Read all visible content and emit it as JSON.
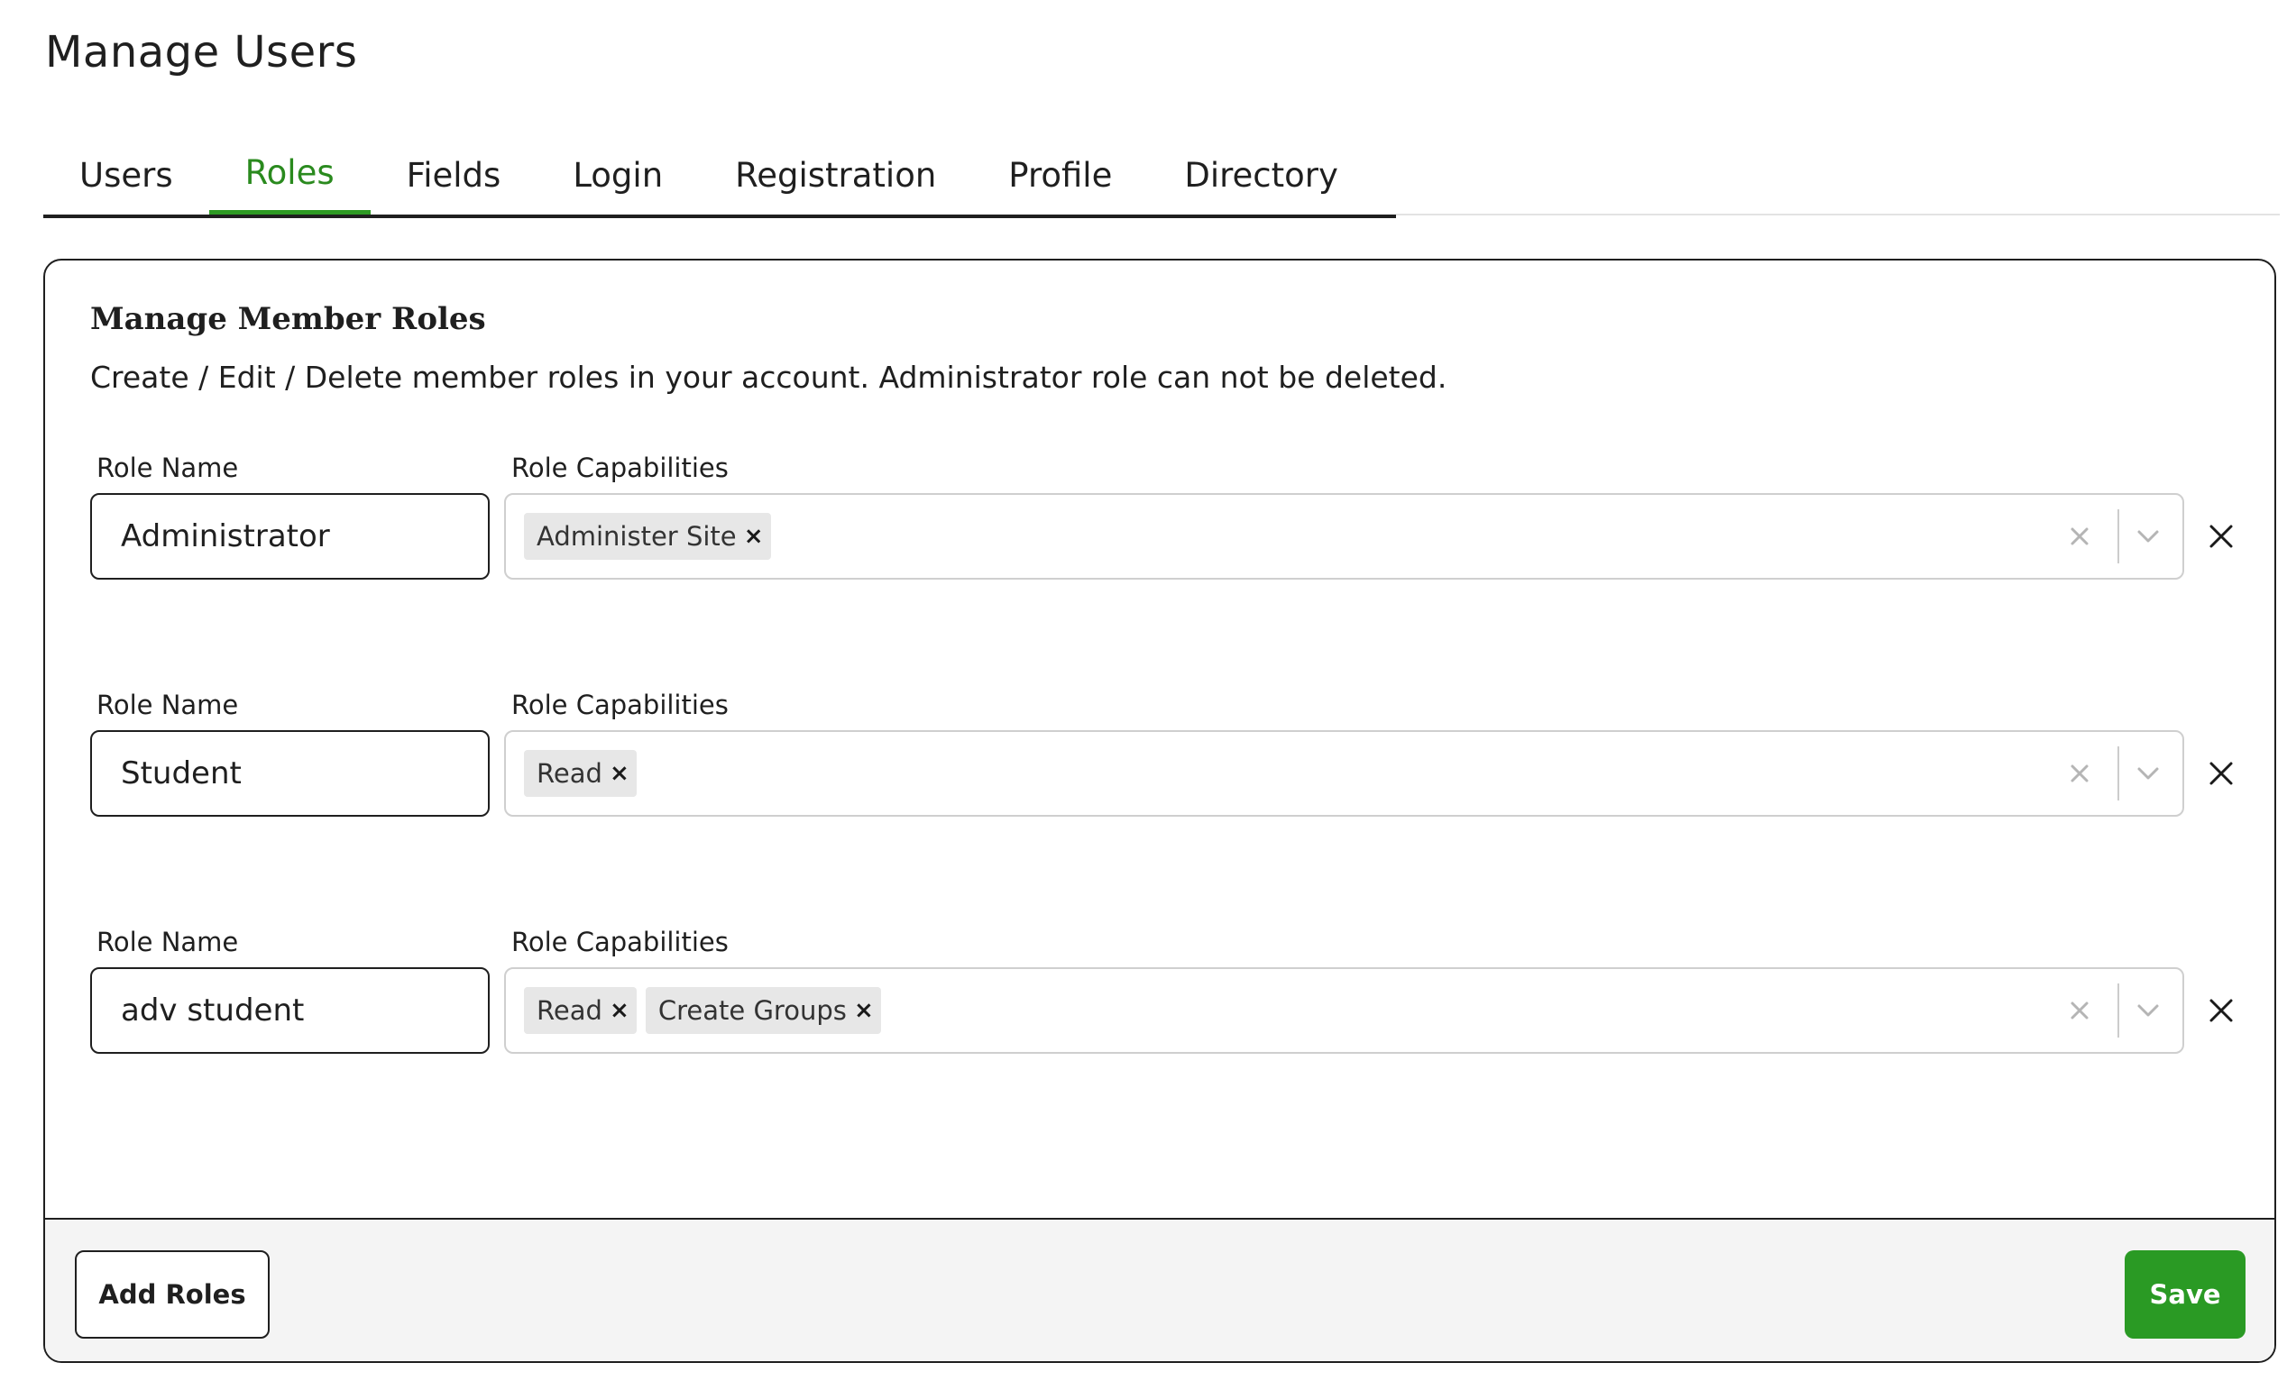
{
  "page": {
    "title": "Manage Users"
  },
  "tabs": [
    {
      "label": "Users"
    },
    {
      "label": "Roles",
      "active": true
    },
    {
      "label": "Fields"
    },
    {
      "label": "Login"
    },
    {
      "label": "Registration"
    },
    {
      "label": "Profile"
    },
    {
      "label": "Directory"
    }
  ],
  "card": {
    "title": "Manage Member Roles",
    "description": "Create / Edit / Delete member roles in your account. Administrator role can not be deleted."
  },
  "labels": {
    "role_name": "Role Name",
    "role_capabilities": "Role Capabilities"
  },
  "roles": [
    {
      "name": "Administrator",
      "capabilities": [
        "Administer Site"
      ]
    },
    {
      "name": "Student",
      "capabilities": [
        "Read"
      ]
    },
    {
      "name": "adv student",
      "capabilities": [
        "Read",
        "Create Groups"
      ]
    }
  ],
  "footer": {
    "add_label": "Add Roles",
    "save_label": "Save"
  },
  "icons": {
    "chip_remove": "close-icon",
    "select_clear": "clear-icon",
    "select_open": "chevron-down-icon",
    "row_remove": "close-icon"
  },
  "colors": {
    "accent": "#2a9a24",
    "active_tab": "#2a8a1e",
    "chip_bg": "#e7e7e7",
    "footer_bg": "#f4f4f4"
  }
}
